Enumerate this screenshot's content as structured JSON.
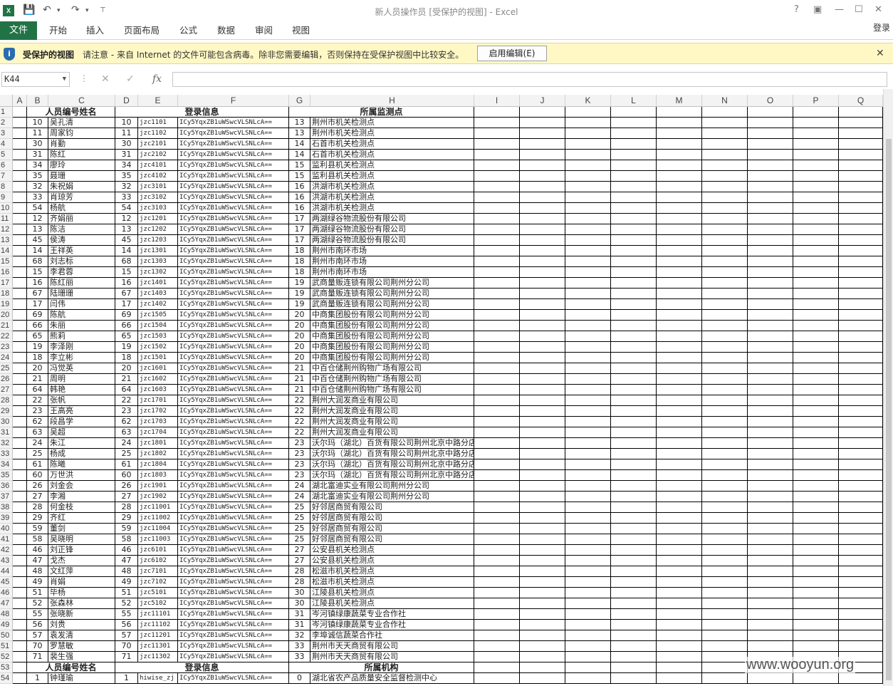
{
  "app": {
    "window_title": "新人员操作员  [受保护的视图] - Excel",
    "logo_text": "X",
    "login_label": "登录"
  },
  "ribbon": {
    "tabs": [
      "文件",
      "开始",
      "插入",
      "页面布局",
      "公式",
      "数据",
      "审阅",
      "视图"
    ]
  },
  "protected_view": {
    "title": "受保护的视图",
    "message": "请注意 - 来自 Internet 的文件可能包含病毒。除非您需要编辑，否则保持在受保护视图中比较安全。",
    "enable_button": "启用编辑(E)"
  },
  "formula_bar": {
    "name_box": "K44",
    "formula": ""
  },
  "columns": [
    "A",
    "B",
    "C",
    "D",
    "E",
    "F",
    "G",
    "H",
    "I",
    "J",
    "K",
    "L",
    "M",
    "N",
    "O",
    "P",
    "Q"
  ],
  "header_row": {
    "row": "1",
    "bc": "人员编号姓名",
    "def": "登录信息",
    "gh": "所属监测点"
  },
  "header_row_53": {
    "row": "53",
    "bc": "人员编号姓名",
    "def": "登录信息",
    "gh": "所属机构"
  },
  "rows": [
    {
      "r": "2",
      "b": "10",
      "c": "吴孔清",
      "d": "10",
      "e": "jzc1101",
      "f": "ICy5YqxZB1uWSwcVLSNLcA==",
      "g": "13",
      "h": "荆州市机关检测点"
    },
    {
      "r": "3",
      "b": "11",
      "c": "周家钧",
      "d": "11",
      "e": "jzc1102",
      "f": "ICy5YqxZB1uWSwcVLSNLcA==",
      "g": "13",
      "h": "荆州市机关检测点"
    },
    {
      "r": "4",
      "b": "30",
      "c": "肖勤",
      "d": "30",
      "e": "jzc2101",
      "f": "ICy5YqxZB1uWSwcVLSNLcA==",
      "g": "14",
      "h": "石首市机关检测点"
    },
    {
      "r": "5",
      "b": "31",
      "c": "陈红",
      "d": "31",
      "e": "jzc2102",
      "f": "ICy5YqxZB1uWSwcVLSNLcA==",
      "g": "14",
      "h": "石首市机关检测点"
    },
    {
      "r": "6",
      "b": "34",
      "c": "廖玲",
      "d": "34",
      "e": "jzc4101",
      "f": "ICy5YqxZB1uWSwcVLSNLcA==",
      "g": "15",
      "h": "监利县机关检测点"
    },
    {
      "r": "7",
      "b": "35",
      "c": "聂珊",
      "d": "35",
      "e": "jzc4102",
      "f": "ICy5YqxZB1uWSwcVLSNLcA==",
      "g": "15",
      "h": "监利县机关检测点"
    },
    {
      "r": "8",
      "b": "32",
      "c": "朱祝娟",
      "d": "32",
      "e": "jzc3101",
      "f": "ICy5YqxZB1uWSwcVLSNLcA==",
      "g": "16",
      "h": "洪湖市机关检测点"
    },
    {
      "r": "9",
      "b": "33",
      "c": "肖琼芳",
      "d": "33",
      "e": "jzc3102",
      "f": "ICy5YqxZB1uWSwcVLSNLcA==",
      "g": "16",
      "h": "洪湖市机关检测点"
    },
    {
      "r": "10",
      "b": "54",
      "c": "杨航",
      "d": "54",
      "e": "jzc3103",
      "f": "ICy5YqxZB1uWSwcVLSNLcA==",
      "g": "16",
      "h": "洪湖市机关检测点"
    },
    {
      "r": "11",
      "b": "12",
      "c": "齐娟丽",
      "d": "12",
      "e": "jzc1201",
      "f": "ICy5YqxZB1uWSwcVLSNLcA==",
      "g": "17",
      "h": "两湖绿谷物流股份有限公司"
    },
    {
      "r": "12",
      "b": "13",
      "c": "陈洁",
      "d": "13",
      "e": "jzc1202",
      "f": "ICy5YqxZB1uWSwcVLSNLcA==",
      "g": "17",
      "h": "两湖绿谷物流股份有限公司"
    },
    {
      "r": "13",
      "b": "45",
      "c": "侯涛",
      "d": "45",
      "e": "jzc1203",
      "f": "ICy5YqxZB1uWSwcVLSNLcA==",
      "g": "17",
      "h": "两湖绿谷物流股份有限公司"
    },
    {
      "r": "14",
      "b": "14",
      "c": "王祥英",
      "d": "14",
      "e": "jzc1301",
      "f": "ICy5YqxZB1uWSwcVLSNLcA==",
      "g": "18",
      "h": "荆州市南环市场"
    },
    {
      "r": "15",
      "b": "68",
      "c": "刘志标",
      "d": "68",
      "e": "jzc1303",
      "f": "ICy5YqxZB1uWSwcVLSNLcA==",
      "g": "18",
      "h": "荆州市南环市场"
    },
    {
      "r": "16",
      "b": "15",
      "c": "李君蓉",
      "d": "15",
      "e": "jzc1302",
      "f": "ICy5YqxZB1uWSwcVLSNLcA==",
      "g": "18",
      "h": "荆州市南环市场"
    },
    {
      "r": "17",
      "b": "16",
      "c": "陈红丽",
      "d": "16",
      "e": "jzc1401",
      "f": "ICy5YqxZB1uWSwcVLSNLcA==",
      "g": "19",
      "h": "武商量贩连锁有限公司荆州分公司"
    },
    {
      "r": "18",
      "b": "67",
      "c": "陆珊珊",
      "d": "67",
      "e": "jzc1403",
      "f": "ICy5YqxZB1uWSwcVLSNLcA==",
      "g": "19",
      "h": "武商量贩连锁有限公司荆州分公司"
    },
    {
      "r": "19",
      "b": "17",
      "c": "闫伟",
      "d": "17",
      "e": "jzc1402",
      "f": "ICy5YqxZB1uWSwcVLSNLcA==",
      "g": "19",
      "h": "武商量贩连锁有限公司荆州分公司"
    },
    {
      "r": "20",
      "b": "69",
      "c": "陈航",
      "d": "69",
      "e": "jzc1505",
      "f": "ICy5YqxZB1uWSwcVLSNLcA==",
      "g": "20",
      "h": "中商集团股份有限公司荆州分公司"
    },
    {
      "r": "21",
      "b": "66",
      "c": "朱丽",
      "d": "66",
      "e": "jzc1504",
      "f": "ICy5YqxZB1uWSwcVLSNLcA==",
      "g": "20",
      "h": "中商集团股份有限公司荆州分公司"
    },
    {
      "r": "22",
      "b": "65",
      "c": "熊莉",
      "d": "65",
      "e": "jzc1503",
      "f": "ICy5YqxZB1uWSwcVLSNLcA==",
      "g": "20",
      "h": "中商集团股份有限公司荆州分公司"
    },
    {
      "r": "23",
      "b": "19",
      "c": "李泽刚",
      "d": "19",
      "e": "jzc1502",
      "f": "ICy5YqxZB1uWSwcVLSNLcA==",
      "g": "20",
      "h": "中商集团股份有限公司荆州分公司"
    },
    {
      "r": "24",
      "b": "18",
      "c": "李立彬",
      "d": "18",
      "e": "jzc1501",
      "f": "ICy5YqxZB1uWSwcVLSNLcA==",
      "g": "20",
      "h": "中商集团股份有限公司荆州分公司"
    },
    {
      "r": "25",
      "b": "20",
      "c": "冯觉英",
      "d": "20",
      "e": "jzc1601",
      "f": "ICy5YqxZB1uWSwcVLSNLcA==",
      "g": "21",
      "h": "中百仓储荆州购物广场有限公司"
    },
    {
      "r": "26",
      "b": "21",
      "c": "周明",
      "d": "21",
      "e": "jzc1602",
      "f": "ICy5YqxZB1uWSwcVLSNLcA==",
      "g": "21",
      "h": "中百仓储荆州购物广场有限公司"
    },
    {
      "r": "27",
      "b": "64",
      "c": "韩艳",
      "d": "64",
      "e": "jzc1603",
      "f": "ICy5YqxZB1uWSwcVLSNLcA==",
      "g": "21",
      "h": "中百仓储荆州购物广场有限公司"
    },
    {
      "r": "28",
      "b": "22",
      "c": "张帆",
      "d": "22",
      "e": "jzc1701",
      "f": "ICy5YqxZB1uWSwcVLSNLcA==",
      "g": "22",
      "h": "荆州大润发商业有限公司"
    },
    {
      "r": "29",
      "b": "23",
      "c": "王高亮",
      "d": "23",
      "e": "jzc1702",
      "f": "ICy5YqxZB1uWSwcVLSNLcA==",
      "g": "22",
      "h": "荆州大润发商业有限公司"
    },
    {
      "r": "30",
      "b": "62",
      "c": "段昌学",
      "d": "62",
      "e": "jzc1703",
      "f": "ICy5YqxZB1uWSwcVLSNLcA==",
      "g": "22",
      "h": "荆州大润发商业有限公司"
    },
    {
      "r": "31",
      "b": "63",
      "c": "吴超",
      "d": "63",
      "e": "jzc1704",
      "f": "ICy5YqxZB1uWSwcVLSNLcA==",
      "g": "22",
      "h": "荆州大润发商业有限公司"
    },
    {
      "r": "32",
      "b": "24",
      "c": "朱江",
      "d": "24",
      "e": "jzc1801",
      "f": "ICy5YqxZB1uWSwcVLSNLcA==",
      "g": "23",
      "h": "沃尔玛（湖北）百货有限公司荆州北京中路分店"
    },
    {
      "r": "33",
      "b": "25",
      "c": "杨成",
      "d": "25",
      "e": "jzc1802",
      "f": "ICy5YqxZB1uWSwcVLSNLcA==",
      "g": "23",
      "h": "沃尔玛（湖北）百货有限公司荆州北京中路分店"
    },
    {
      "r": "34",
      "b": "61",
      "c": "陈曦",
      "d": "61",
      "e": "jzc1804",
      "f": "ICy5YqxZB1uWSwcVLSNLcA==",
      "g": "23",
      "h": "沃尔玛（湖北）百货有限公司荆州北京中路分店"
    },
    {
      "r": "35",
      "b": "60",
      "c": "万世洪",
      "d": "60",
      "e": "jzc1803",
      "f": "ICy5YqxZB1uWSwcVLSNLcA==",
      "g": "23",
      "h": "沃尔玛（湖北）百货有限公司荆州北京中路分店"
    },
    {
      "r": "36",
      "b": "26",
      "c": "刘金会",
      "d": "26",
      "e": "jzc1901",
      "f": "ICy5YqxZB1uWSwcVLSNLcA==",
      "g": "24",
      "h": "湖北富迪实业有限公司荆州分公司"
    },
    {
      "r": "37",
      "b": "27",
      "c": "李湘",
      "d": "27",
      "e": "jzc1902",
      "f": "ICy5YqxZB1uWSwcVLSNLcA==",
      "g": "24",
      "h": "湖北富迪实业有限公司荆州分公司"
    },
    {
      "r": "38",
      "b": "28",
      "c": "何金枝",
      "d": "28",
      "e": "jzc11001",
      "f": "ICy5YqxZB1uWSwcVLSNLcA==",
      "g": "25",
      "h": "好邻居商贸有限公司"
    },
    {
      "r": "39",
      "b": "29",
      "c": "齐红",
      "d": "29",
      "e": "jzc11002",
      "f": "ICy5YqxZB1uWSwcVLSNLcA==",
      "g": "25",
      "h": "好邻居商贸有限公司"
    },
    {
      "r": "40",
      "b": "59",
      "c": "董剑",
      "d": "59",
      "e": "jzc11004",
      "f": "ICy5YqxZB1uWSwcVLSNLcA==",
      "g": "25",
      "h": "好邻居商贸有限公司"
    },
    {
      "r": "41",
      "b": "58",
      "c": "吴晓明",
      "d": "58",
      "e": "jzc11003",
      "f": "ICy5YqxZB1uWSwcVLSNLcA==",
      "g": "25",
      "h": "好邻居商贸有限公司"
    },
    {
      "r": "42",
      "b": "46",
      "c": "刘正锋",
      "d": "46",
      "e": "jzc6101",
      "f": "ICy5YqxZB1uWSwcVLSNLcA==",
      "g": "27",
      "h": "公安县机关检测点"
    },
    {
      "r": "43",
      "b": "47",
      "c": "戈杰",
      "d": "47",
      "e": "jzc6102",
      "f": "ICy5YqxZB1uWSwcVLSNLcA==",
      "g": "27",
      "h": "公安县机关检测点"
    },
    {
      "r": "44",
      "b": "48",
      "c": "文红萍",
      "d": "48",
      "e": "jzc7101",
      "f": "ICy5YqxZB1uWSwcVLSNLcA==",
      "g": "28",
      "h": "松滋市机关检测点"
    },
    {
      "r": "45",
      "b": "49",
      "c": "肖娟",
      "d": "49",
      "e": "jzc7102",
      "f": "ICy5YqxZB1uWSwcVLSNLcA==",
      "g": "28",
      "h": "松滋市机关检测点"
    },
    {
      "r": "46",
      "b": "51",
      "c": "毕杨",
      "d": "51",
      "e": "jzc5101",
      "f": "ICy5YqxZB1uWSwcVLSNLcA==",
      "g": "30",
      "h": "江陵县机关检测点"
    },
    {
      "r": "47",
      "b": "52",
      "c": "张森林",
      "d": "52",
      "e": "jzc5102",
      "f": "ICy5YqxZB1uWSwcVLSNLcA==",
      "g": "30",
      "h": "江陵县机关检测点"
    },
    {
      "r": "48",
      "b": "55",
      "c": "张晓新",
      "d": "55",
      "e": "jzc11101",
      "f": "ICy5YqxZB1uWSwcVLSNLcA==",
      "g": "31",
      "h": "岑河镇绿康蔬菜专业合作社"
    },
    {
      "r": "49",
      "b": "56",
      "c": "刘贵",
      "d": "56",
      "e": "jzc11102",
      "f": "ICy5YqxZB1uWSwcVLSNLcA==",
      "g": "31",
      "h": "岑河镇绿康蔬菜专业合作社"
    },
    {
      "r": "50",
      "b": "57",
      "c": "袁发清",
      "d": "57",
      "e": "jzc11201",
      "f": "ICy5YqxZB1uWSwcVLSNLcA==",
      "g": "32",
      "h": "李埠诚信蔬菜合作社"
    },
    {
      "r": "51",
      "b": "70",
      "c": "罗慧敏",
      "d": "70",
      "e": "jzc11301",
      "f": "ICy5YqxZB1uWSwcVLSNLcA==",
      "g": "33",
      "h": "荆州市天天商贸有限公司"
    },
    {
      "r": "52",
      "b": "71",
      "c": "裴生强",
      "d": "71",
      "e": "jzc11302",
      "f": "ICy5YqxZB1uWSwcVLSNLcA==",
      "g": "33",
      "h": "荆州市天天商贸有限公司"
    }
  ],
  "row_54": {
    "r": "54",
    "b": "1",
    "c": "钟瑾瑜",
    "d": "1",
    "e": "hiwise_zj",
    "f": "ICy5YqxZB1uWSwcVLSNLcA==",
    "g": "0",
    "h": "湖北省农产品质量安全监督检测中心"
  },
  "watermark": "www.wooyun.org",
  "colors": {
    "excel_green": "#217346",
    "msgbar_bg": "#fff8c5"
  }
}
